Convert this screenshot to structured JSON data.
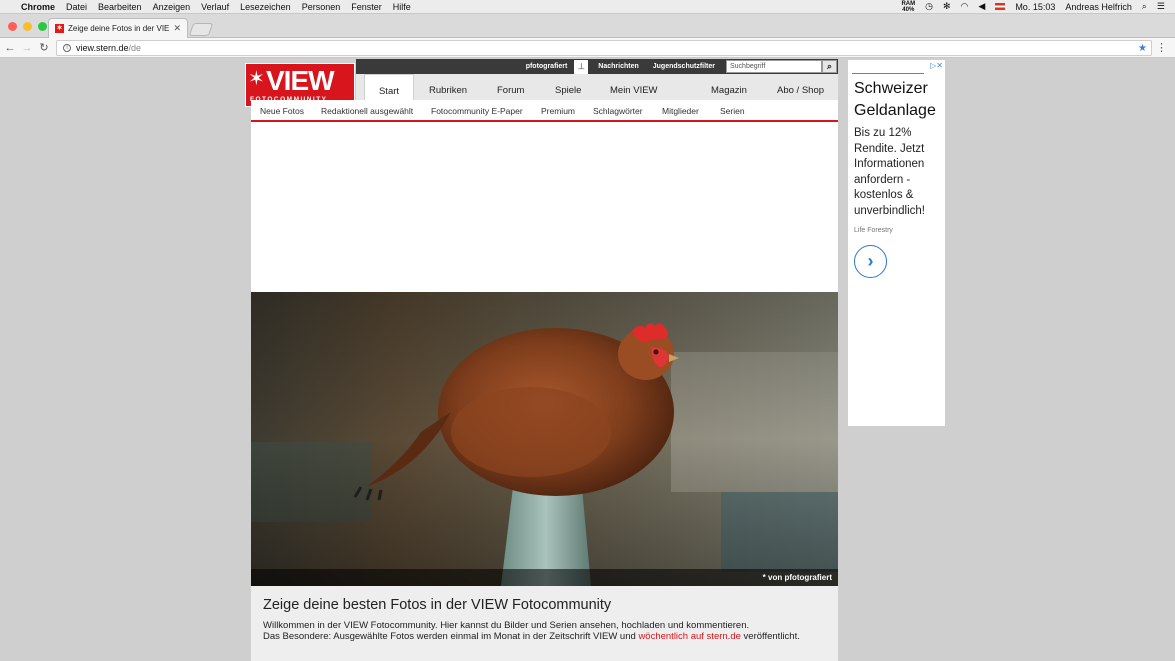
{
  "menubar": {
    "app": "Chrome",
    "items": [
      "Datei",
      "Bearbeiten",
      "Anzeigen",
      "Verlauf",
      "Lesezeichen",
      "Personen",
      "Fenster",
      "Hilfe"
    ],
    "ram_label": "RAM",
    "ram_value": "40%",
    "clock": "Mo. 15:03",
    "user": "Andreas Helfrich"
  },
  "tab": {
    "title": "Zeige deine Fotos in der VIEW",
    "favicon": "stern"
  },
  "address": {
    "host": "view.stern.de",
    "path": "/de"
  },
  "site": {
    "logo_main": "VIEW",
    "logo_sub": "FOTOCOMMUNITY",
    "brand_color": "#d8151c",
    "topbar": {
      "pin_user": "pfotografiert",
      "links": [
        "Nachrichten",
        "Jugendschutzfilter"
      ],
      "search_placeholder": "Suchbegriff"
    },
    "mainnav": [
      "Start",
      "Rubriken",
      "Forum",
      "Spiele",
      "Mein VIEW",
      "Magazin",
      "Abo / Shop"
    ],
    "subnav": [
      "Neue Fotos",
      "Redaktionell ausgewählt",
      "Fotocommunity E-Paper",
      "Premium",
      "Schlagwörter",
      "Mitglieder",
      "Serien"
    ],
    "photo_credit": "* von pfotografiert",
    "headline": "Zeige deine besten Fotos in der VIEW Fotocommunity",
    "intro_line1": "Willkommen in der VIEW Fotocommunity. Hier kannst du Bilder und Serien ansehen, hochladen und kommentieren.",
    "intro_line2_a": "Das Besondere: Ausgewählte Fotos werden einmal im Monat in der Zeitschrift VIEW und ",
    "intro_line2_link": "wöchentlich auf stern.de",
    "intro_line2_b": " veröffentlicht."
  },
  "side_ad": {
    "headline": "Schweizer Geldanlage",
    "body": "Bis zu 12% Rendite. Jetzt Informationen anfordern - kostenlos & unverbindlich!",
    "source": "Life Forestry"
  }
}
